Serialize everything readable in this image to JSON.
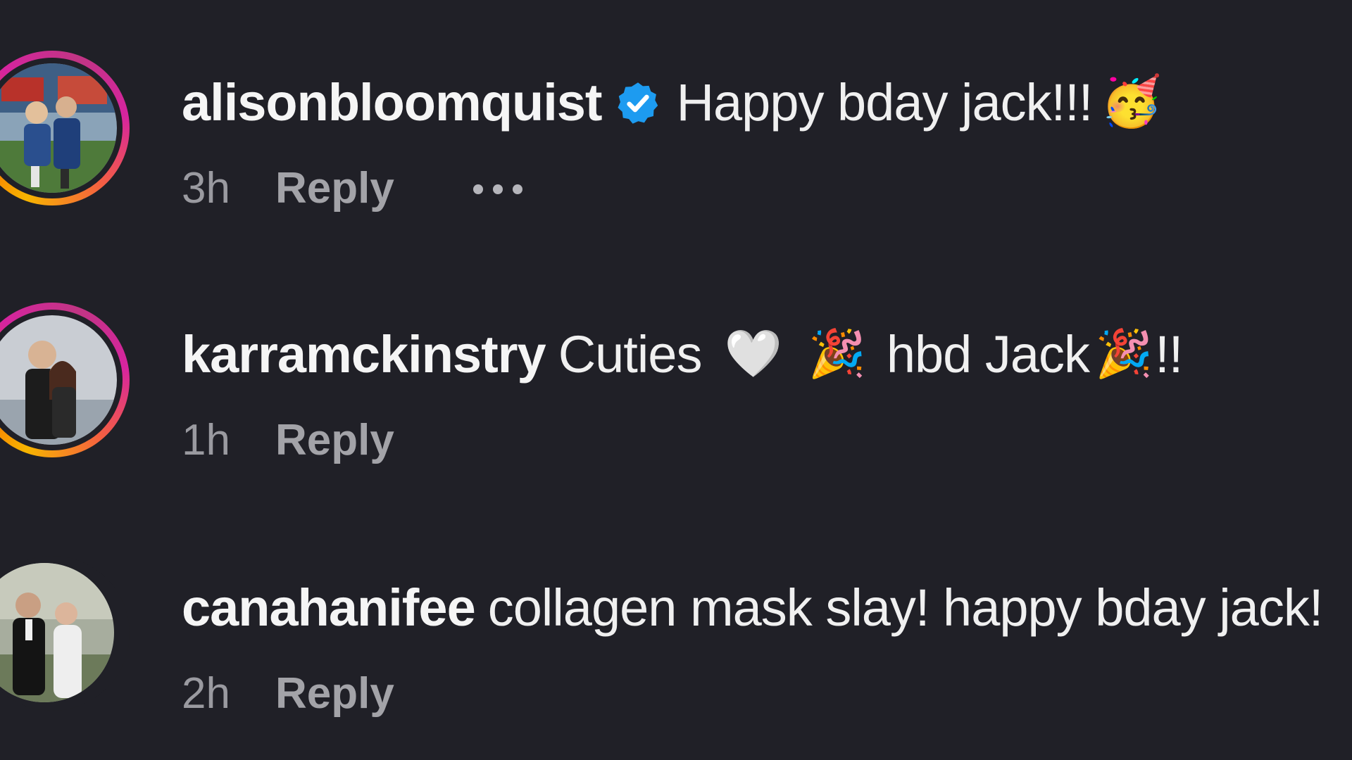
{
  "comments": [
    {
      "username": "alisonbloomquist",
      "verified": true,
      "text": "Happy bday jack!!!",
      "emoji_after": "🥳",
      "time": "3h",
      "reply_label": "Reply",
      "has_more": true,
      "story_ring": true
    },
    {
      "username": "karramckinstry",
      "verified": false,
      "text_parts": [
        "Cuties",
        "🤍",
        "🎉",
        "hbd Jack",
        "🎉",
        "!!"
      ],
      "time": "1h",
      "reply_label": "Reply",
      "has_more": false,
      "story_ring": true
    },
    {
      "username": "canahanifee",
      "verified": false,
      "text": "collagen mask slay! happy bday jack!",
      "time": "2h",
      "reply_label": "Reply",
      "has_more": false,
      "story_ring": false
    }
  ],
  "colors": {
    "background": "#202027",
    "verified_badge": "#1d9bf0",
    "meta_text": "#9a9aa0"
  },
  "icons": {
    "verified": "verified-badge-icon",
    "more": "more-options-icon"
  }
}
